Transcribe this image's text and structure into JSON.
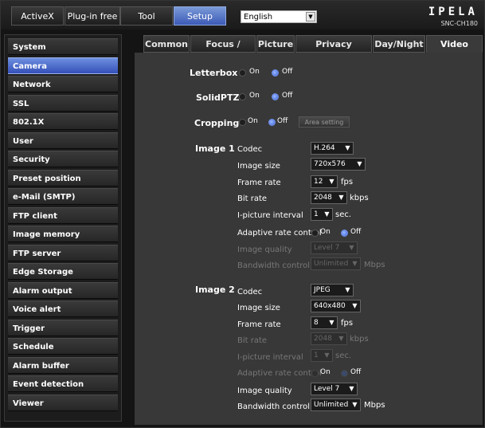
{
  "topbar": {
    "buttons": [
      "ActiveX",
      "Plug-in free",
      "Tool",
      "Setup"
    ],
    "language": "English",
    "brand": "IPELA",
    "model": "SNC-CH180"
  },
  "sidebar": {
    "items": [
      "System",
      "Camera",
      "Network",
      "SSL",
      "802.1X",
      "User",
      "Security",
      "Preset position",
      "e-Mail (SMTP)",
      "FTP client",
      "Image memory",
      "FTP server",
      "Edge Storage",
      "Alarm output",
      "Voice alert",
      "Trigger",
      "Schedule",
      "Alarm buffer",
      "Event detection",
      "Viewer"
    ],
    "active": "Camera"
  },
  "tabs": [
    "Common",
    "Focus / Zoom",
    "Picture",
    "Privacy masking",
    "Day/Night",
    "Video codec"
  ],
  "settings": {
    "letterbox": {
      "label": "Letterbox",
      "on": "On",
      "off": "Off"
    },
    "solidptz": {
      "label": "SolidPTZ",
      "on": "On",
      "off": "Off"
    },
    "cropping": {
      "label": "Cropping",
      "on": "On",
      "off": "Off",
      "area_button": "Area setting"
    }
  },
  "image1": {
    "title": "Image 1",
    "codec_label": "Codec",
    "codec": "H.264",
    "size_label": "Image size",
    "size": "720x576",
    "frame_label": "Frame rate",
    "frame": "12",
    "frame_unit": "fps",
    "bitrate_label": "Bit rate",
    "bitrate": "2048",
    "bitrate_unit": "kbps",
    "ipi_label": "I-picture interval",
    "ipi": "1",
    "ipi_unit": "sec.",
    "arc_label": "Adaptive rate control",
    "arc_on": "On",
    "arc_off": "Off",
    "quality_label": "Image quality",
    "quality": "Level 7",
    "bwc_label": "Bandwidth control",
    "bwc": "Unlimited",
    "bwc_unit": "Mbps"
  },
  "image2": {
    "title": "Image 2",
    "codec_label": "Codec",
    "codec": "JPEG",
    "size_label": "Image size",
    "size": "640x480",
    "frame_label": "Frame rate",
    "frame": "8",
    "frame_unit": "fps",
    "bitrate_label": "Bit rate",
    "bitrate": "2048",
    "bitrate_unit": "kbps",
    "ipi_label": "I-picture interval",
    "ipi": "1",
    "ipi_unit": "sec.",
    "arc_label": "Adaptive rate control",
    "arc_on": "On",
    "arc_off": "Off",
    "quality_label": "Image quality",
    "quality": "Level 7",
    "bwc_label": "Bandwidth control",
    "bwc": "Unlimited",
    "bwc_unit": "Mbps"
  }
}
